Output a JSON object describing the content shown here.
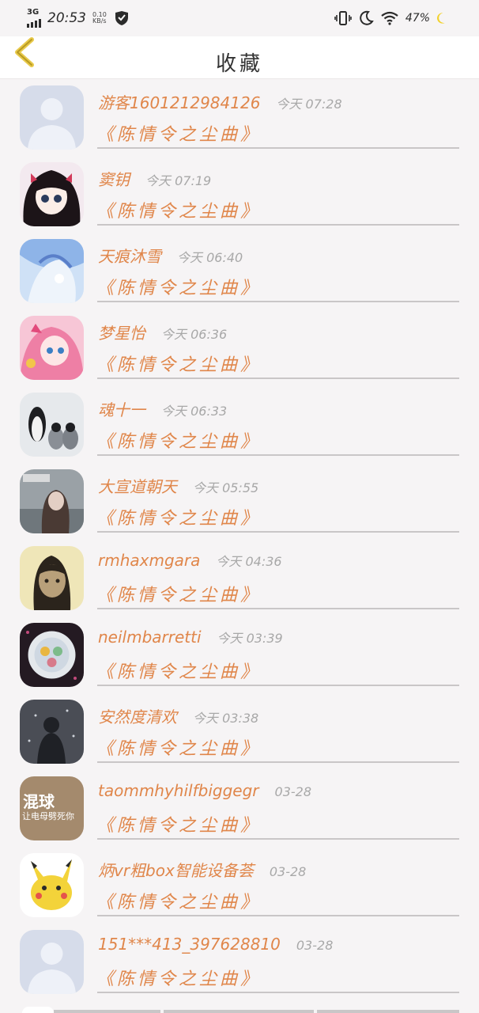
{
  "status_bar": {
    "network": "3G",
    "time": "20:53",
    "speed_value": "0.10",
    "speed_unit": "KB/s",
    "battery": "47%"
  },
  "header": {
    "title": "收藏",
    "back_icon": "chevron-left-icon"
  },
  "colors": {
    "accent": "#e0864a",
    "back_arrow": "#e8c94a",
    "divider": "#c9c6c7",
    "muted_text": "#a8a8a8"
  },
  "items": [
    {
      "name": "游客1601212984126",
      "time": "今天 07:28",
      "title": "《陈情令之尘曲》",
      "avatar": "default-avatar"
    },
    {
      "name": "窦钥",
      "time": "今天 07:19",
      "title": "《陈情令之尘曲》",
      "avatar": "anime-girl-avatar"
    },
    {
      "name": "天痕沐雪",
      "time": "今天 06:40",
      "title": "《陈情令之尘曲》",
      "avatar": "blue-anime-avatar"
    },
    {
      "name": "梦星怡",
      "time": "今天 06:36",
      "title": "《陈情令之尘曲》",
      "avatar": "pink-anime-avatar"
    },
    {
      "name": "魂十一",
      "time": "今天 06:33",
      "title": "《陈情令之尘曲》",
      "avatar": "penguins-avatar"
    },
    {
      "name": "大宣道朝天",
      "time": "今天 05:55",
      "title": "《陈情令之尘曲》",
      "avatar": "girl-photo-avatar"
    },
    {
      "name": "rmhaxmgara",
      "time": "今天 04:36",
      "title": "《陈情令之尘曲》",
      "avatar": "man-photo-avatar"
    },
    {
      "name": "neilmbarretti",
      "time": "今天 03:39",
      "title": "《陈情令之尘曲》",
      "avatar": "plate-avatar"
    },
    {
      "name": "安然度清欢",
      "time": "今天 03:38",
      "title": "《陈情令之尘曲》",
      "avatar": "dark-figure-avatar"
    },
    {
      "name": "taommhyhilfbiggegr",
      "time": "03-28",
      "title": "《陈情令之尘曲》",
      "avatar": "text-avatar",
      "avatar_text_1": "混球",
      "avatar_text_2": "让电母劈死你"
    },
    {
      "name": "炳vr粗box智能设备荟",
      "time": "03-28",
      "title": "《陈情令之尘曲》",
      "avatar": "pikachu-avatar"
    },
    {
      "name": "151***413_397628810",
      "time": "03-28",
      "title": "《陈情令之尘曲》",
      "avatar": "default-avatar"
    }
  ]
}
